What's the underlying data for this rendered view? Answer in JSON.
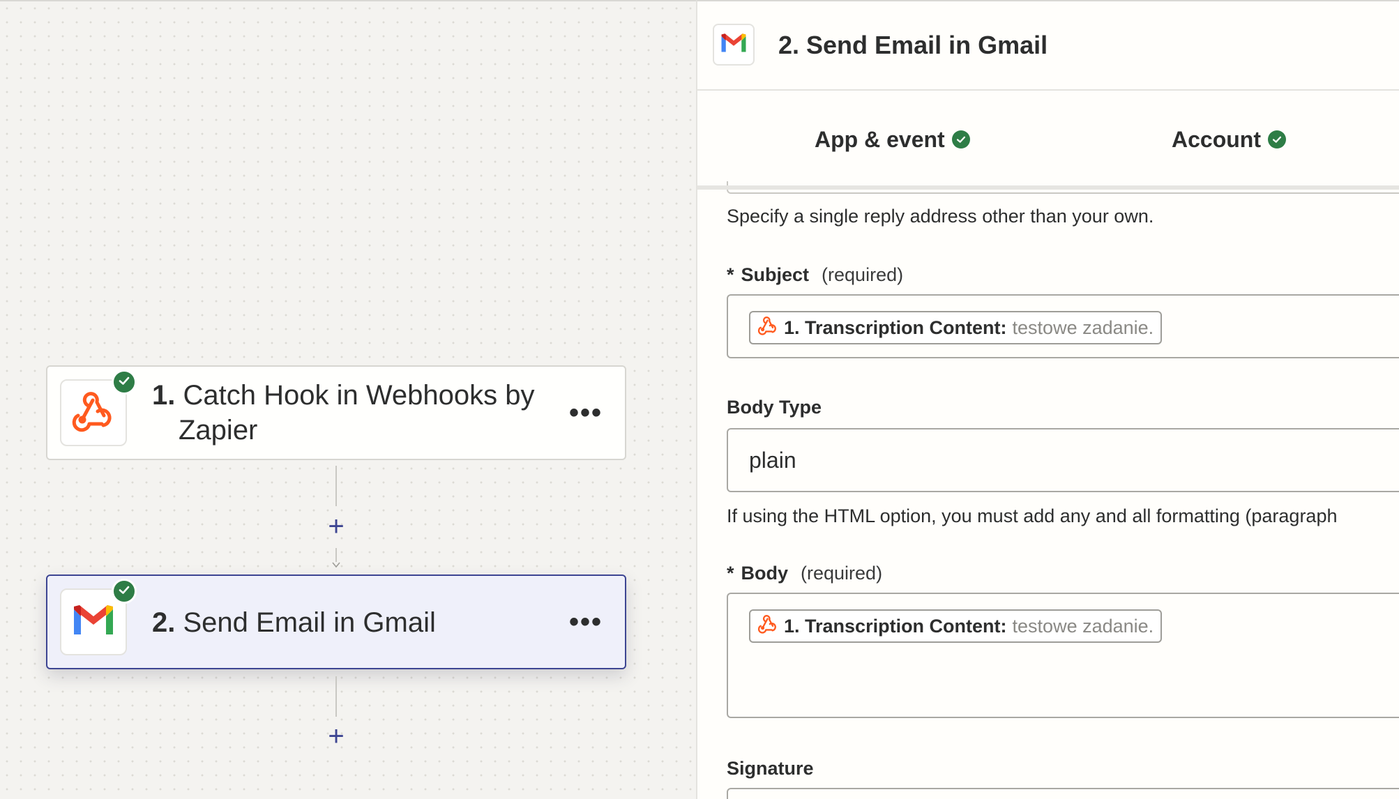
{
  "colors": {
    "accent": "#3d4592",
    "success": "#2e7d46",
    "webhook": "#ff5a1f"
  },
  "canvas": {
    "steps": [
      {
        "number": "1.",
        "title": "Catch Hook in Webhooks by Zapier",
        "title_line1": "Catch Hook in Webhooks by",
        "title_line2": "Zapier",
        "icon": "webhook-icon",
        "status": "complete",
        "menu": "•••"
      },
      {
        "number": "2.",
        "title": "Send Email in Gmail",
        "icon": "gmail-icon",
        "status": "complete",
        "menu": "•••"
      }
    ],
    "add_step_symbol": "+"
  },
  "panel": {
    "title": "2. Send Email in Gmail",
    "icon": "gmail-icon",
    "tabs": [
      {
        "label": "App & event",
        "status": "complete"
      },
      {
        "label": "Account",
        "status": "complete"
      }
    ],
    "reply_to_help": "Specify a single reply address other than your own.",
    "subject": {
      "star": "*",
      "label": "Subject",
      "required": "(required)",
      "pill_source": "1. Transcription Content:",
      "pill_value": "testowe zadanie."
    },
    "body_type": {
      "label": "Body Type",
      "value": "plain",
      "help": "If using the HTML option, you must add any and all formatting (paragraph"
    },
    "body": {
      "star": "*",
      "label": "Body",
      "required": "(required)",
      "pill_source": "1. Transcription Content:",
      "pill_value": "testowe zadanie."
    },
    "signature": {
      "label": "Signature"
    }
  }
}
